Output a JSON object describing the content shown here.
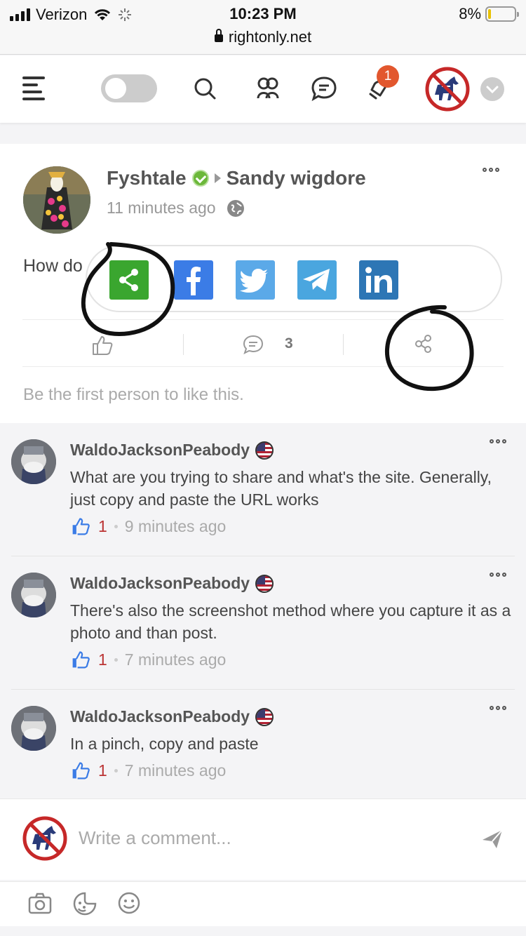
{
  "status_bar": {
    "carrier": "Verizon",
    "time": "10:23 PM",
    "battery": "8%",
    "url": "rightonly.net"
  },
  "header": {
    "notification_count": "1"
  },
  "post": {
    "author": "Fyshtale",
    "target": "Sandy wigdore",
    "time": "11 minutes ago",
    "text": "How do",
    "comment_count": "3",
    "like_prompt": "Be the first person to like this."
  },
  "share_options": [
    "share-icon",
    "facebook-icon",
    "twitter-icon",
    "telegram-icon",
    "linkedin-icon"
  ],
  "comments": [
    {
      "author": "WaldoJacksonPeabody",
      "text": "What are you trying to share and what's the site. Generally, just copy and paste the URL works",
      "likes": "1",
      "time": "9 minutes ago"
    },
    {
      "author": "WaldoJacksonPeabody",
      "text": "There's also the screenshot method where you capture it as a photo and than post.",
      "likes": "1",
      "time": "7 minutes ago"
    },
    {
      "author": "WaldoJacksonPeabody",
      "text": "In a pinch, copy and paste",
      "likes": "1",
      "time": "7 minutes ago"
    }
  ],
  "composer": {
    "placeholder": "Write a comment..."
  },
  "colors": {
    "share_green": "#3aa62f",
    "facebook": "#3b7ce6",
    "twitter": "#5ba9e8",
    "telegram": "#4aa6df",
    "linkedin": "#2d76b5",
    "badge": "#e2572e"
  }
}
